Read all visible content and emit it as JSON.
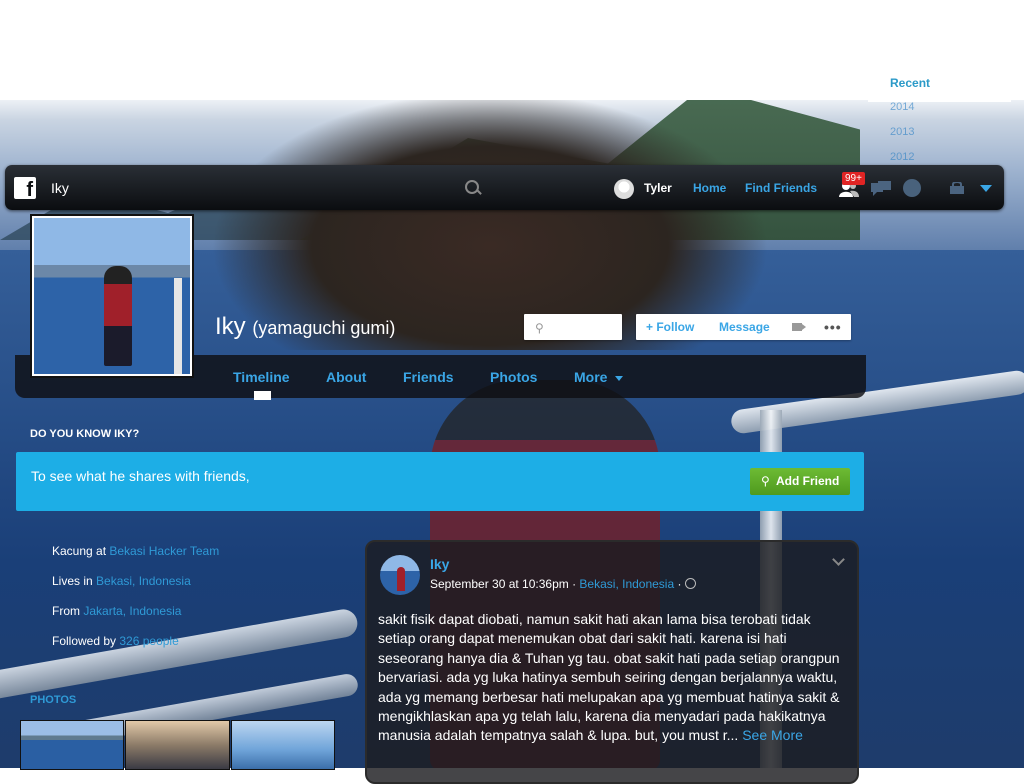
{
  "topbar": {
    "logo": "f",
    "search_value": "Iky",
    "user_name": "Tyler",
    "home_label": "Home",
    "find_friends_label": "Find Friends",
    "friend_requests_badge": "99+",
    "icons": [
      "facebook-logo",
      "search-icon",
      "friend-requests-icon",
      "messages-icon",
      "notifications-globe-icon",
      "privacy-lock-icon",
      "account-caret-icon"
    ]
  },
  "recent": {
    "title": "Recent",
    "years": [
      "2014",
      "2013",
      "2012"
    ]
  },
  "profile": {
    "name": "Iky",
    "alternate_name": "(yamaguchi gumi)",
    "friend_button_icon": "⚲",
    "follow_label": "+ Follow",
    "message_label": "Message",
    "more_label": "•••",
    "tabs": [
      "Timeline",
      "About",
      "Friends",
      "Photos",
      "More"
    ]
  },
  "do_you_know": {
    "title": "DO YOU KNOW IKY?",
    "text": "To see what he shares with friends,",
    "add_friend_label": "Add Friend",
    "add_friend_icon": "⚲"
  },
  "intro": {
    "works_prefix": "Kacung at ",
    "works_link": "Bekasi Hacker Team",
    "lives_prefix": "Lives in ",
    "lives_link": "Bekasi, Indonesia",
    "from_prefix": "From ",
    "from_link": "Jakarta, Indonesia",
    "followed_prefix": "Followed by ",
    "followed_link": "326 people"
  },
  "photos": {
    "title": "PHOTOS"
  },
  "post": {
    "author": "Iky",
    "date": "September 30 at 10:36pm · ",
    "location": "Bekasi, Indonesia",
    "privacy_sep": " · ",
    "body": "sakit fisik dapat diobati, namun sakit hati akan lama bisa terobati tidak setiap orang dapat menemukan obat dari sakit hati. karena isi hati seseorang hanya dia & Tuhan yg tau. obat sakit hati pada setiap orangpun bervariasi. ada yg luka hatinya sembuh seiring dengan berjalannya waktu, ada yg memang berbesar hati melupakan apa yg membuat hatinya sakit & mengikhlaskan apa yg telah lalu, karena dia menyadari pada hakikatnya manusia adalah tempatnya salah & lupa. but, you must r... ",
    "see_more": "See More"
  }
}
